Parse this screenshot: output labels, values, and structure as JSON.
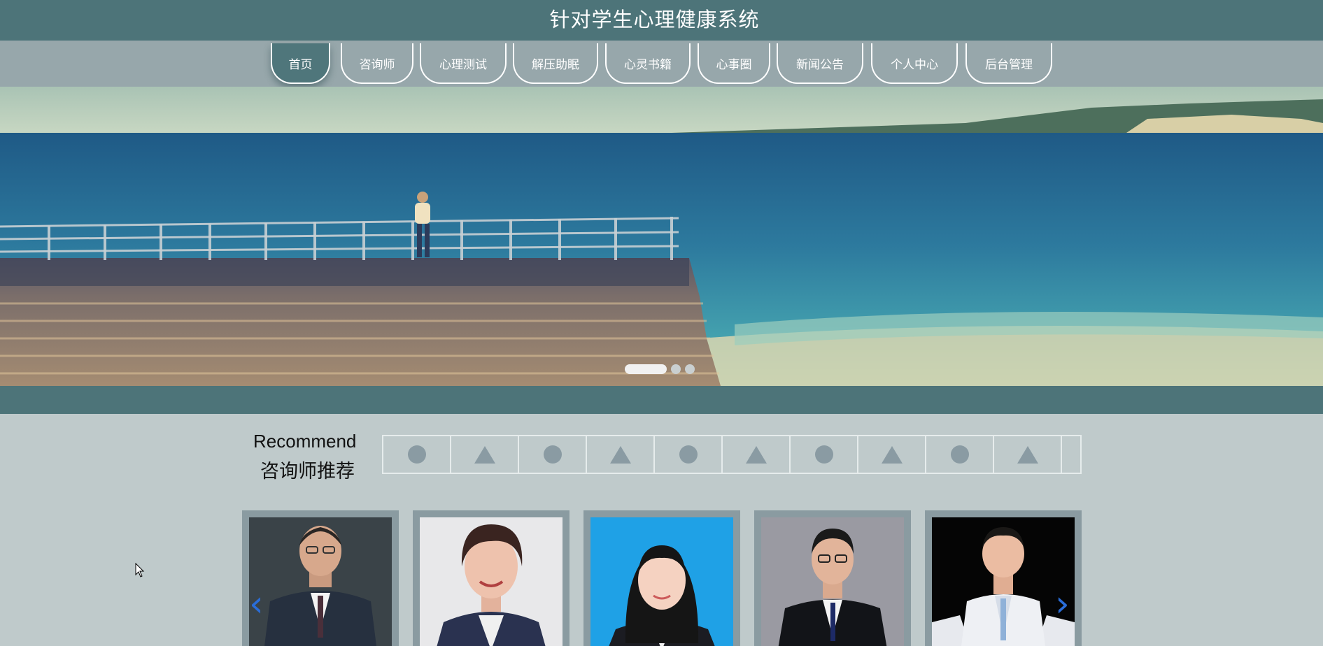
{
  "header": {
    "title": "针对学生心理健康系统"
  },
  "nav": {
    "items": [
      {
        "label": "首页",
        "active": true
      },
      {
        "label": "咨询师"
      },
      {
        "label": "心理测试"
      },
      {
        "label": "解压助眠"
      },
      {
        "label": "心灵书籍"
      },
      {
        "label": "心事圈"
      },
      {
        "label": "新闻公告"
      },
      {
        "label": "个人中心"
      },
      {
        "label": "后台管理"
      }
    ]
  },
  "banner": {
    "slides_total": 3,
    "active_slide": 1
  },
  "recommend": {
    "title_en": "Recommend",
    "title_cn": "咨询师推荐",
    "shapes": [
      "circle",
      "triangle",
      "circle",
      "triangle",
      "circle",
      "triangle",
      "circle",
      "triangle",
      "circle",
      "triangle"
    ]
  },
  "counselors": [
    {
      "photo": "counselor-1-photo"
    },
    {
      "photo": "counselor-2-photo"
    },
    {
      "photo": "counselor-3-photo"
    },
    {
      "photo": "counselor-4-photo"
    },
    {
      "photo": "counselor-5-photo"
    }
  ],
  "colors": {
    "header_bg": "#4d7479",
    "nav_bg": "#97a7ab",
    "page_bg": "#bfcacb",
    "arrow": "#2a6dd8"
  }
}
